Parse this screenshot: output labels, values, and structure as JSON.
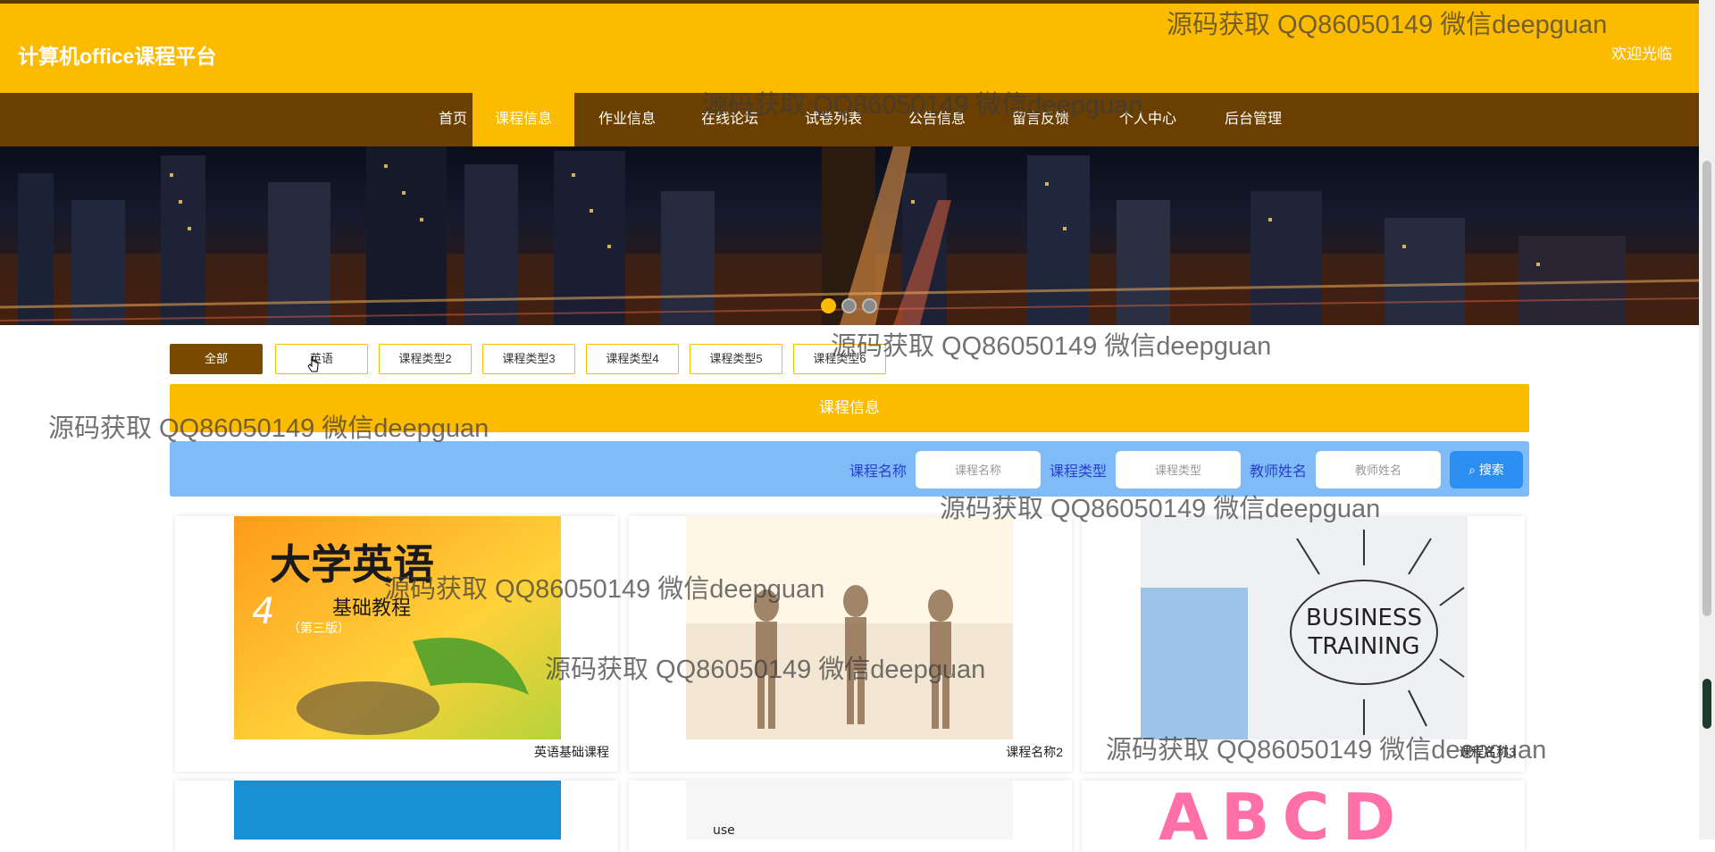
{
  "header": {
    "title": "计算机office课程平台",
    "welcome": "欢迎光临"
  },
  "nav": {
    "items": [
      "首页",
      "课程信息",
      "作业信息",
      "在线论坛",
      "试卷列表",
      "公告信息",
      "留言反馈",
      "个人中心",
      "后台管理"
    ],
    "active_index": 1
  },
  "carousel": {
    "dot_count": 3,
    "active_index": 0
  },
  "filters": {
    "items": [
      "全部",
      "英语",
      "课程类型2",
      "课程类型3",
      "课程类型4",
      "课程类型5",
      "课程类型6"
    ],
    "active_index": 0
  },
  "section": {
    "title": "课程信息"
  },
  "search": {
    "course_name_label": "课程名称",
    "course_name_placeholder": "课程名称",
    "course_type_label": "课程类型",
    "course_type_placeholder": "课程类型",
    "teacher_label": "教师姓名",
    "teacher_placeholder": "教师姓名",
    "button_label": "搜索"
  },
  "courses": [
    {
      "name": "英语基础课程",
      "image": "english-textbook-cover",
      "cover_title": "大学英语",
      "cover_subtitle": "基础教程",
      "cover_number": "4",
      "cover_edition": "（第三版）"
    },
    {
      "name": "课程名称2",
      "image": "yoga-class-photo"
    },
    {
      "name": "课程名称3",
      "image": "business-training-drawing",
      "image_text_line1": "BUSINESS",
      "image_text_line2": "TRAINING"
    },
    {
      "name": "",
      "image": "blue-background-photo"
    },
    {
      "name": "",
      "image": "text-collage-photo",
      "image_text": "use"
    },
    {
      "name": "",
      "image": "colorful-alphabet-letters",
      "image_text": "ABCD"
    }
  ],
  "watermark": "源码获取 QQ86050149 微信deepguan",
  "colors": {
    "brand_yellow": "#fdbb00",
    "nav_brown": "#6b3f00",
    "search_blue": "#7fbbf7",
    "label_blue": "#2a3fd0",
    "search_button": "#2b8ef0"
  }
}
